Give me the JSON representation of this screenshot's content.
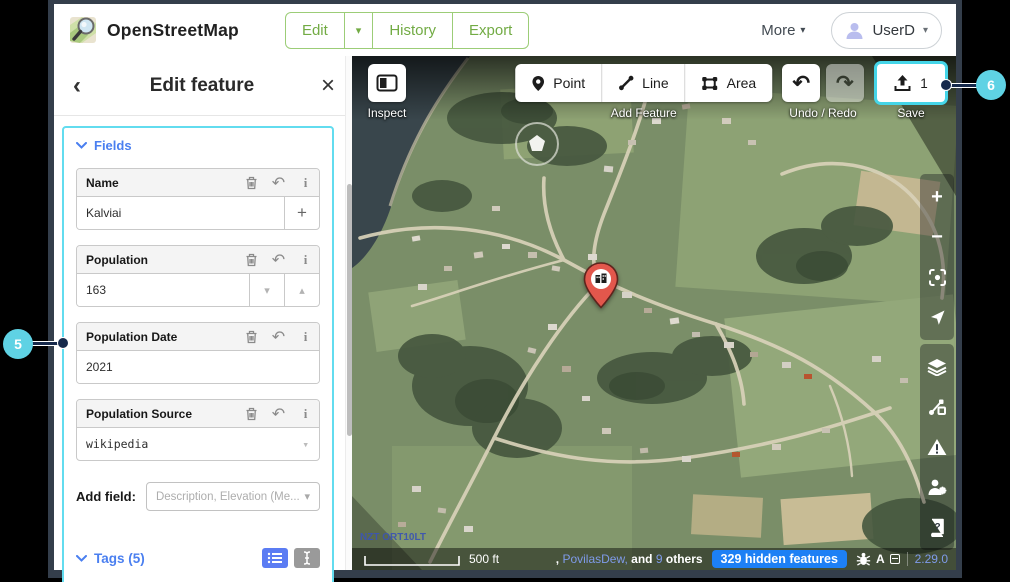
{
  "colors": {
    "accent_cyan": "#45d5e8",
    "callout_cyan": "#5fd2e4",
    "section_blue": "#4a7ff0",
    "link_blue": "#7f9bea",
    "badge_blue": "#1d80f5",
    "osm_green": "#72ab44",
    "pin_red": "#e2574c"
  },
  "topbar": {
    "app_title": "OpenStreetMap",
    "edit": "Edit",
    "history": "History",
    "export": "Export",
    "more": "More",
    "user": "UserD"
  },
  "sidebar": {
    "title": "Edit feature",
    "fields_section": "Fields",
    "fields": [
      {
        "label": "Name",
        "value": "Kalviai"
      },
      {
        "label": "Population",
        "value": "163"
      },
      {
        "label": "Population Date",
        "value": "2021"
      },
      {
        "label": "Population Source",
        "value": "wikipedia"
      }
    ],
    "add_field_label": "Add field:",
    "add_field_placeholder": "Description, Elevation (Me...",
    "tags_section": "Tags (5)"
  },
  "map_toolbar": {
    "inspect": "Inspect",
    "point": "Point",
    "line": "Line",
    "area": "Area",
    "add_feature": "Add Feature",
    "undo_redo": "Undo / Redo",
    "save": "Save",
    "save_count": "1"
  },
  "statusbar": {
    "scale": "500 ft",
    "edits_prefix": ", ",
    "edits_user": "PovilasDew,",
    "edits_and": " and ",
    "edits_count": "9",
    "edits_others": " others",
    "hidden_features": "329 hidden features",
    "translate_letter": "A",
    "version": "2.29.0"
  },
  "map": {
    "imagery_attribution": "NZT ORT10LT"
  },
  "callouts": {
    "left": "5",
    "right": "6"
  },
  "icons": {
    "back": "‹",
    "close": "×",
    "caret_down": "▾",
    "caret_up": "▴",
    "plus": "+",
    "info": "i",
    "undo": "↶",
    "redo": "↷",
    "zoom_in": "+",
    "zoom_out": "−"
  }
}
